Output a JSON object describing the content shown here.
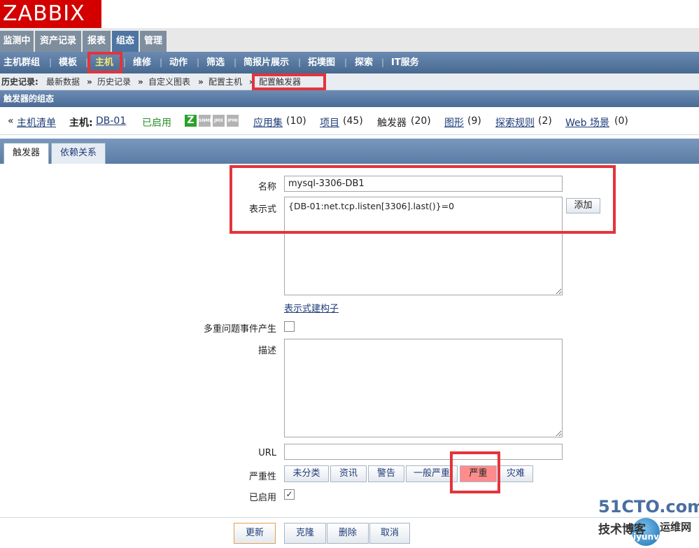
{
  "logo": "ZABBIX",
  "main_menu": [
    "监测中",
    "资产记录",
    "报表",
    "组态",
    "管理"
  ],
  "sub_menu": [
    "主机群组",
    "模板",
    "主机",
    "维修",
    "动作",
    "筛选",
    "简报片展示",
    "拓墣图",
    "探索",
    "IT服务"
  ],
  "breadcrumb": {
    "label": "历史记录:",
    "items": [
      "最新数据",
      "历史记录",
      "自定义图表",
      "配置主机",
      "配置触发器"
    ]
  },
  "section_title": "触发器的组态",
  "host_nav": {
    "host_list": "主机清单",
    "host_label": "主机:",
    "host_name": "DB-01",
    "status": "已启用",
    "apps": "应用集",
    "apps_count": "(10)",
    "items": "项目",
    "items_count": "(45)",
    "triggers": "触发器",
    "triggers_count": "(20)",
    "graphs": "图形",
    "graphs_count": "(9)",
    "discovery": "探索规则",
    "discovery_count": "(2)",
    "web": "Web 场景",
    "web_count": "(0)",
    "icons": [
      "Z",
      "SNMP",
      "JMX",
      "IPMI"
    ]
  },
  "tabs": [
    "触发器",
    "依赖关系"
  ],
  "form": {
    "name_label": "名称",
    "name_value": "mysql-3306-DB1",
    "expr_label": "表示式",
    "expr_value": "{DB-01:net.tcp.listen[3306].last()}=0",
    "add_button": "添加",
    "expr_builder": "表示式建构子",
    "multi_label": "多重问题事件产生",
    "desc_label": "描述",
    "url_label": "URL",
    "severity_label": "严重性",
    "severities": [
      "未分类",
      "资讯",
      "警告",
      "一般严重",
      "严重",
      "灾难"
    ],
    "selected_severity": "严重",
    "enabled_label": "已启用",
    "enabled_checked": true
  },
  "buttons": [
    "更新",
    "克隆",
    "删除",
    "取消"
  ],
  "watermark": {
    "line1": "51CTO.com",
    "line2": "技术博客",
    "line3": "iyunv.com",
    "line4": "运维网"
  }
}
